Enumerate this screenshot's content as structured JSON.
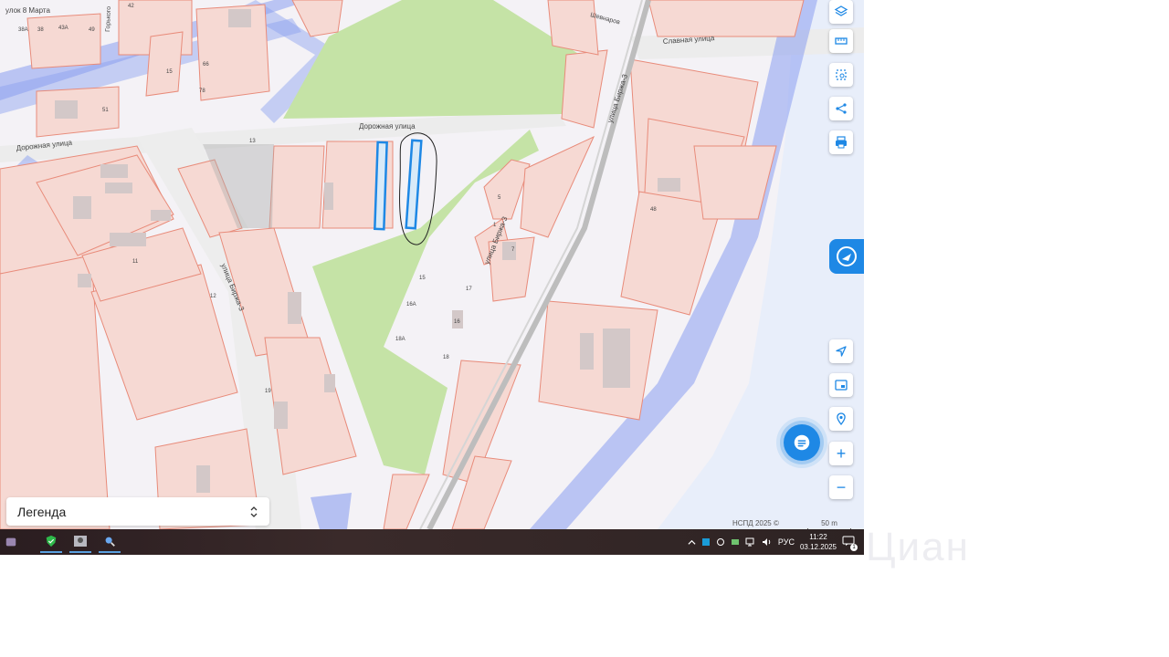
{
  "map": {
    "streets": [
      {
        "id": "dorozhnaya-1",
        "text": "Дорожная улица"
      },
      {
        "id": "dorozhnaya-2",
        "text": "Дорожная улица"
      },
      {
        "id": "slavnaya",
        "text": "Славная улица"
      },
      {
        "id": "birzha-1",
        "text": "улица Биржа-3"
      },
      {
        "id": "birzha-2",
        "text": "улица Биржа-3"
      },
      {
        "id": "birzha-3",
        "text": "улица Биржа-3"
      },
      {
        "id": "pereulok",
        "text": "улок 8 Марта"
      },
      {
        "id": "gorkogo",
        "text": "Горького"
      },
      {
        "id": "shevnyarov",
        "text": "Шевнаров"
      }
    ],
    "house_numbers": [
      "38А",
      "38",
      "43А",
      "49",
      "42",
      "51",
      "66",
      "78",
      "15",
      "11",
      "13",
      "1",
      "5",
      "7",
      "15",
      "16А",
      "17",
      "16",
      "18А",
      "18",
      "48",
      "19",
      "12"
    ]
  },
  "toolbar": {
    "buttons": [
      {
        "name": "layers-button",
        "icon": "layers-icon"
      },
      {
        "name": "ruler-button",
        "icon": "ruler-icon"
      },
      {
        "name": "area-select-button",
        "icon": "area-select-icon"
      },
      {
        "name": "share-button",
        "icon": "share-icon"
      },
      {
        "name": "print-button",
        "icon": "print-icon"
      },
      {
        "name": "locate-button",
        "icon": "navigation-arrow-icon"
      },
      {
        "name": "minimap-button",
        "icon": "minimap-icon"
      },
      {
        "name": "pin-search-button",
        "icon": "pin-search-icon"
      },
      {
        "name": "zoom-in-button",
        "icon": "plus-icon",
        "label": "+"
      },
      {
        "name": "zoom-out-button",
        "icon": "minus-icon",
        "label": "−"
      }
    ]
  },
  "legend": {
    "label": "Легенда"
  },
  "attribution": "НСПД 2025 ©",
  "scale": {
    "label": "50 m"
  },
  "taskbar": {
    "apps": [
      "app-icon",
      "shield-icon",
      "photo-app-icon",
      "search-app-icon"
    ],
    "tray": {
      "lang": "РУС",
      "time": "11:22",
      "date": "03.12.2025",
      "notifications": "1"
    }
  },
  "watermark": "Циан",
  "colors": {
    "parcel_fill": "#f6d9d3",
    "parcel_stroke": "#e88b7a",
    "green_area": "#c5e3a6",
    "zone_blue": "#8a9ff0",
    "highlight": "#1e88e5",
    "accent": "#1e88e5"
  }
}
